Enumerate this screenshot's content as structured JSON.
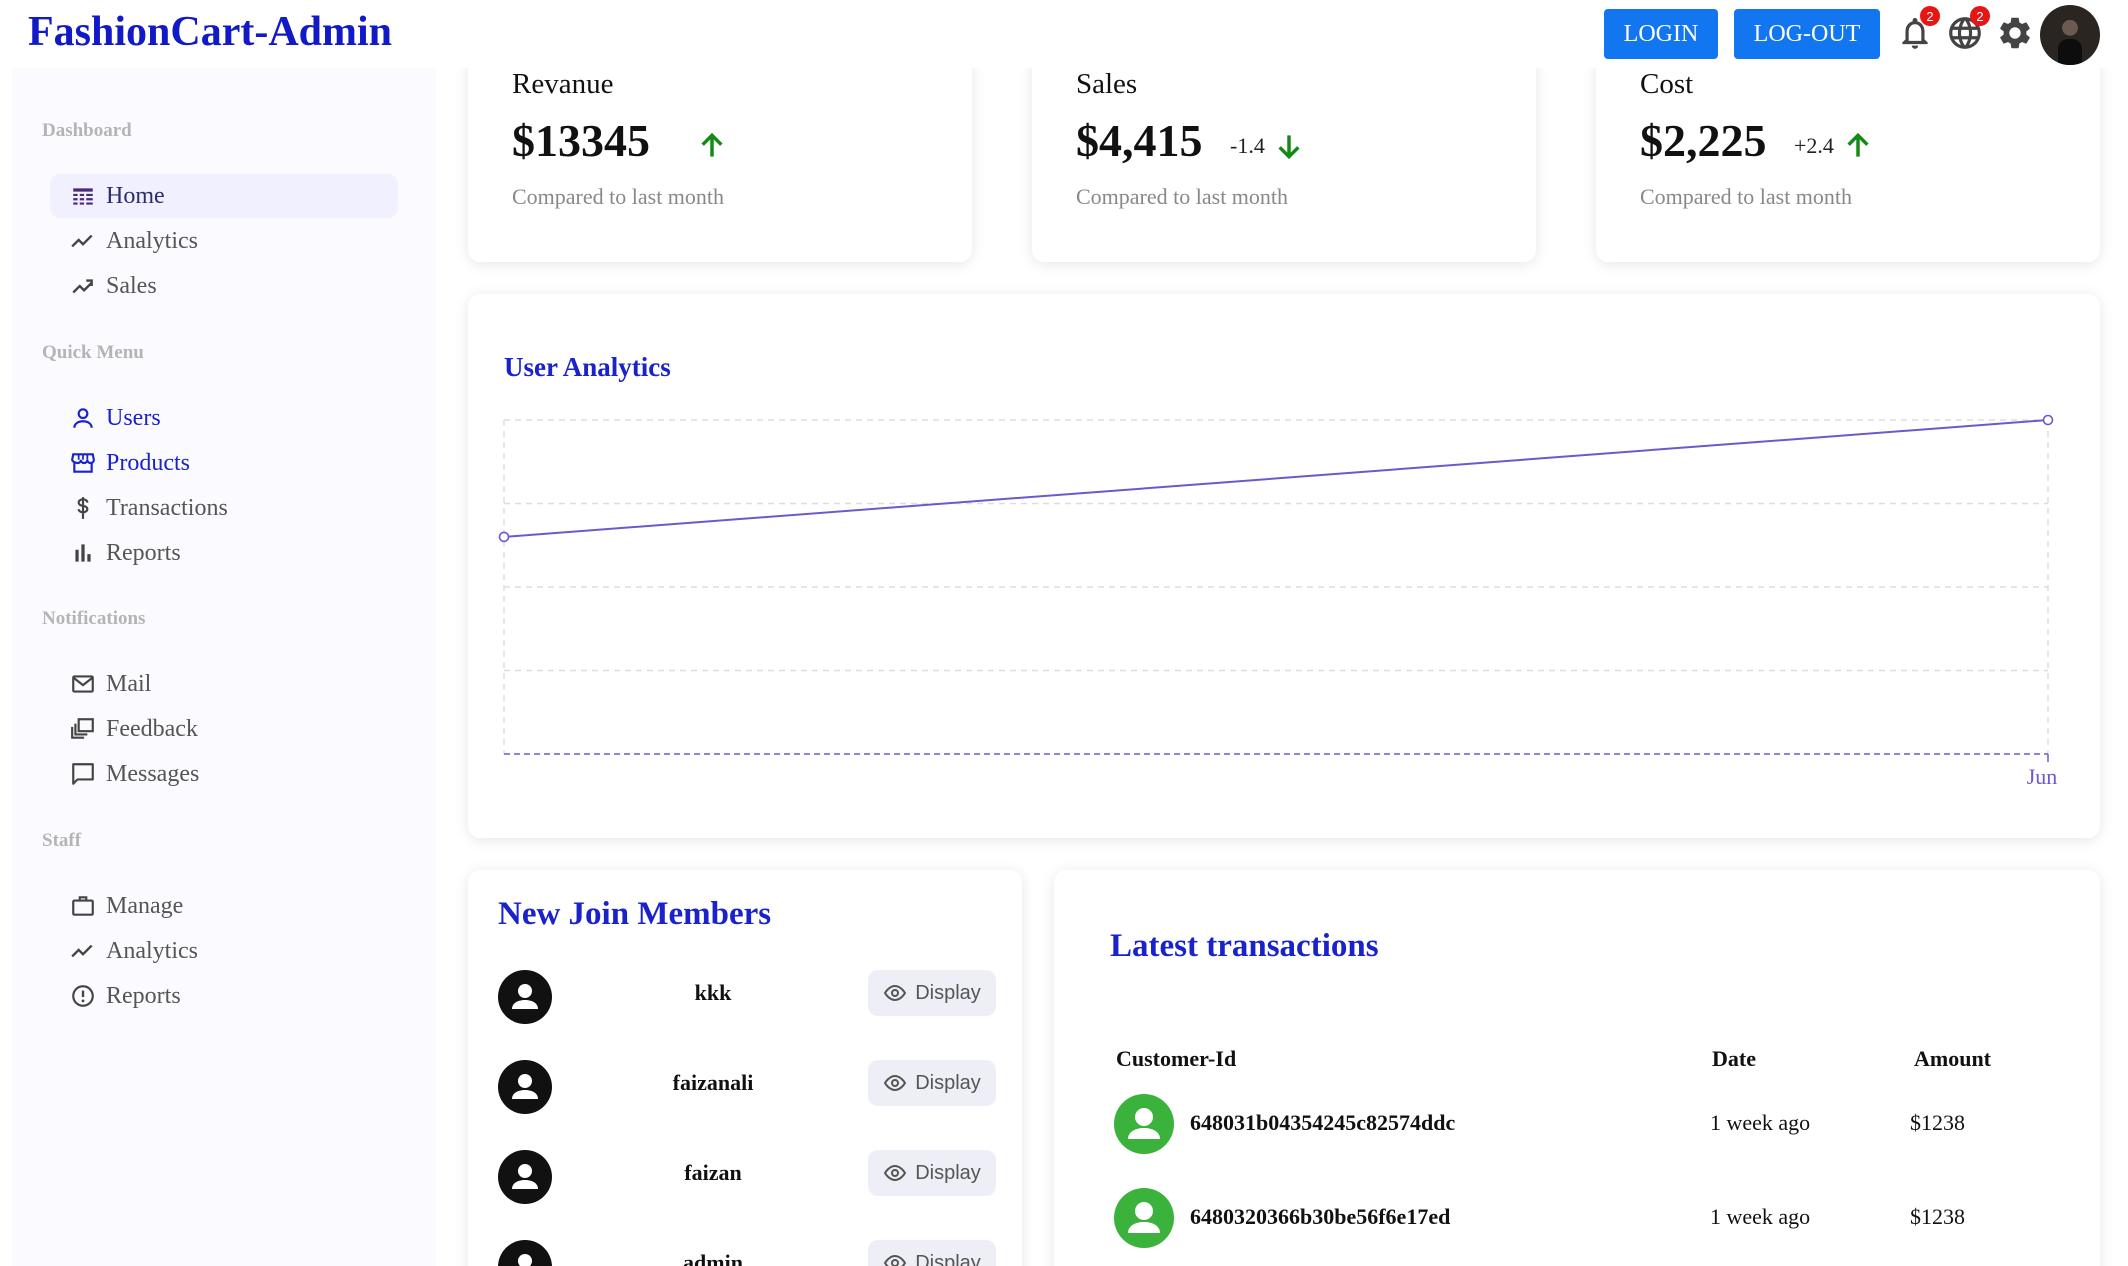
{
  "app": {
    "title": "FashionCart-Admin"
  },
  "topbar": {
    "login_label": "LOGIN",
    "logout_label": "LOG-OUT",
    "notifications_badge": "2",
    "language_badge": "2",
    "accent_color": "#1176f0"
  },
  "sidebar": {
    "sections": [
      {
        "title": "Dashboard",
        "items": [
          {
            "label": "Home",
            "icon": "dashboard-icon"
          },
          {
            "label": "Analytics",
            "icon": "timeline-icon"
          },
          {
            "label": "Sales",
            "icon": "trending-up-icon"
          }
        ]
      },
      {
        "title": "Quick Menu",
        "items": [
          {
            "label": "Users",
            "icon": "user-icon"
          },
          {
            "label": "Products",
            "icon": "storefront-icon"
          },
          {
            "label": "Transactions",
            "icon": "dollar-icon"
          },
          {
            "label": "Reports",
            "icon": "bar-chart-icon"
          }
        ]
      },
      {
        "title": "Notifications",
        "items": [
          {
            "label": "Mail",
            "icon": "mail-icon"
          },
          {
            "label": "Feedback",
            "icon": "feedback-icon"
          },
          {
            "label": "Messages",
            "icon": "chat-bubble-icon"
          }
        ]
      },
      {
        "title": "Staff",
        "items": [
          {
            "label": "Manage",
            "icon": "briefcase-icon"
          },
          {
            "label": "Analytics",
            "icon": "timeline-icon"
          },
          {
            "label": "Reports",
            "icon": "report-icon"
          }
        ]
      }
    ]
  },
  "featured": [
    {
      "title": "Revanue",
      "money": "$13345",
      "rate": "",
      "trend": "up",
      "sub": "Compared to last month"
    },
    {
      "title": "Sales",
      "money": "$4,415",
      "rate": "-1.4",
      "trend": "down",
      "sub": "Compared to last month"
    },
    {
      "title": "Cost",
      "money": "$2,225",
      "rate": "+2.4",
      "trend": "up",
      "sub": "Compared to last month"
    }
  ],
  "chart": {
    "title": "User Analytics",
    "line_color": "#6a5acd",
    "title_color": "#1a22c9"
  },
  "chart_data": {
    "type": "line",
    "title": "User Analytics",
    "x": [
      "",
      "Jun"
    ],
    "series": [
      {
        "values": [
          2.6,
          4
        ]
      }
    ],
    "ylim": [
      0,
      4
    ],
    "grid": true,
    "xlabel": "",
    "ylabel": ""
  },
  "members": {
    "title": "New Join Members",
    "button_label": "Display",
    "items": [
      {
        "name": "kkk"
      },
      {
        "name": "faizanali"
      },
      {
        "name": "faizan"
      },
      {
        "name": "admin"
      }
    ]
  },
  "transactions": {
    "title": "Latest transactions",
    "headers": {
      "customer": "Customer-Id",
      "date": "Date",
      "amount": "Amount"
    },
    "rows": [
      {
        "id": "648031b04354245c82574ddc",
        "date": "1 week ago",
        "amount": "$1238"
      },
      {
        "id": "6480320366b30be56f6e17ed",
        "date": "1 week ago",
        "amount": "$1238"
      }
    ]
  }
}
